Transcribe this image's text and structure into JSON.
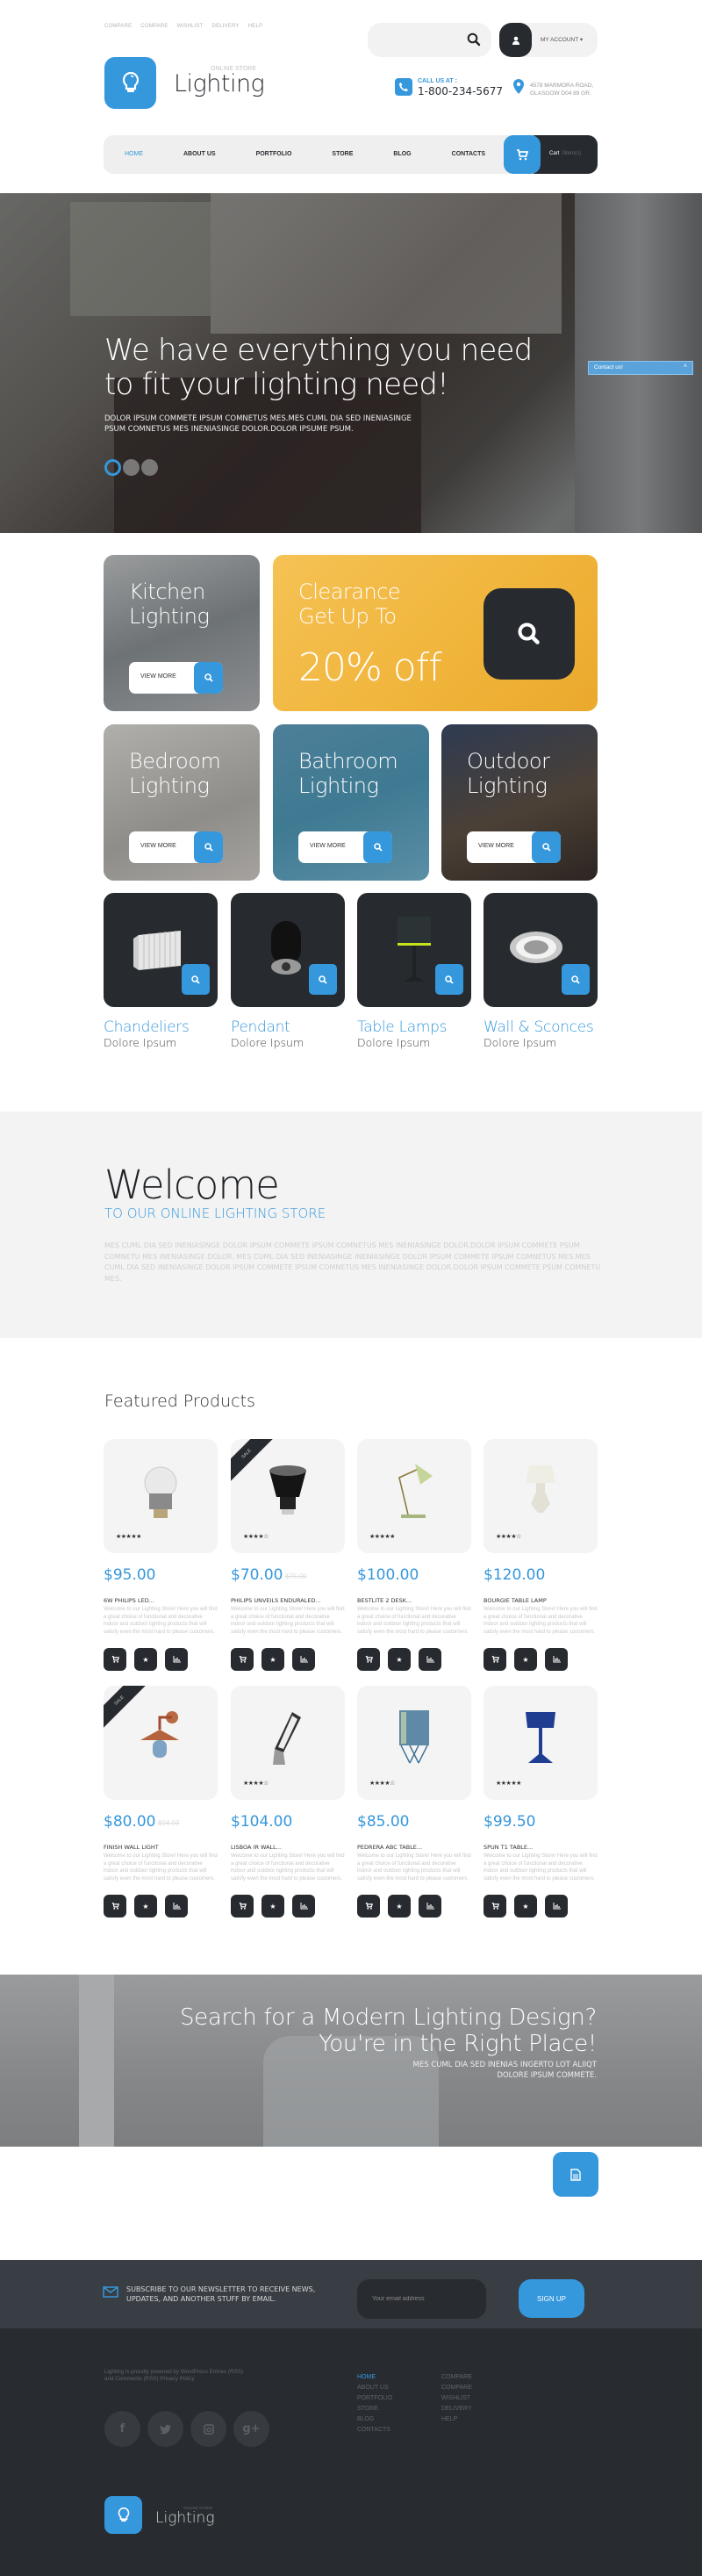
{
  "header": {
    "top_links": [
      "COMPARE",
      "COMPARE",
      "WISHLIST",
      "DELIVERY",
      "HELP"
    ],
    "logo": {
      "subtitle": "ONLINE STORE",
      "title": "Lighting",
      "icon": "lightbulb-icon"
    },
    "search": {
      "placeholder": "",
      "icon": "search-icon"
    },
    "account": {
      "label": "MY ACCOUNT",
      "icon": "user-icon"
    },
    "call": {
      "label": "CALL US AT :",
      "number": "1-800-234-5677",
      "icon": "phone-icon"
    },
    "address": {
      "line1": "4578 MARMORA ROAD,",
      "line2": "GLASGOW D04 89 GR.",
      "icon": "map-pin-icon"
    }
  },
  "nav": {
    "items": [
      {
        "label": "HOME",
        "active": true
      },
      {
        "label": "ABOUT US",
        "active": false
      },
      {
        "label": "PORTFOLIO",
        "active": false
      },
      {
        "label": "STORE",
        "active": false
      },
      {
        "label": "BLOG",
        "active": false
      },
      {
        "label": "CONTACTS",
        "active": false
      }
    ],
    "cart": {
      "label": "Cart",
      "count": "0item(s)",
      "icon": "cart-icon"
    }
  },
  "hero": {
    "title_line1": "We have everything you need",
    "title_line2": "to fit your lighting need!",
    "text_line1": "DOLOR IPSUM COMMETE IPSUM COMNETUS MES.MES CUML DIA SED INENIASINGE",
    "text_line2": "PSUM COMNETUS MES INENIASINGE DOLOR.DOLOR IPSUME PSUM.",
    "slides": 3,
    "active_slide": 1,
    "contact_tab": "Contact us!"
  },
  "categories": {
    "view_more": "VIEW MORE",
    "kitchen": {
      "line1": "Kitchen",
      "line2": "Lighting"
    },
    "clearance": {
      "line1": "Clearance",
      "line2": "Get Up To",
      "offer": "20% off"
    },
    "bedroom": {
      "line1": "Bedroom",
      "line2": "Lighting"
    },
    "bathroom": {
      "line1": "Bathroom",
      "line2": "Lighting"
    },
    "outdoor": {
      "line1": "Outdoor",
      "line2": "Lighting"
    }
  },
  "product_categories": [
    {
      "name": "Chandeliers",
      "sub": "Dolore Ipsum"
    },
    {
      "name": "Pendant",
      "sub": "Dolore Ipsum"
    },
    {
      "name": "Table Lamps",
      "sub": "Dolore Ipsum"
    },
    {
      "name": "Wall & Sconces",
      "sub": "Dolore Ipsum"
    }
  ],
  "welcome": {
    "title": "Welcome",
    "subtitle": "TO OUR ONLINE LIGHTING STORE",
    "text": "MES CUML DIA SED INENIASINGE DOLOR IPSUM COMMETE IPSUM COMNETUS MES INENIASINGE DOLOR.DOLOR IPSUM COMMETE PSUM COMNETU MES INENIASINGE DOLOR. MES CUML DIA SED INENIASINGE INENIASINGE DOLOR IPSUM COMMETE IPSUM COMNETUS MES.MES CUML DIA SED INENIASINGE DOLOR IPSUM COMMETE IPSUM COMNETUS MES INENIASINGE DOLOR.DOLOR IPSUM COMMETE PSUM COMNETU MES."
  },
  "featured": {
    "title": "Featured Products",
    "sale_label": "SALE",
    "description": "Welcome to our Lighting Store! Here you will find a great choice of functional and decorative indoor and outdoor lighting products that will satisfy even the most hard to please customers.",
    "products": [
      {
        "name": "6W PHILIPS LED...",
        "price": "$95.00",
        "old_price": "",
        "stars": "★★★★★",
        "sale": false
      },
      {
        "name": "PHILIPS UNVEILS ENDURALED...",
        "price": "$70.00",
        "old_price": "$75.00",
        "stars": "★★★★☆",
        "sale": true
      },
      {
        "name": "BESTLITE 2 DESK...",
        "price": "$100.00",
        "old_price": "",
        "stars": "★★★★★",
        "sale": false
      },
      {
        "name": "BOURGIE TABLE LAMP",
        "price": "$120.00",
        "old_price": "",
        "stars": "★★★★☆",
        "sale": false
      },
      {
        "name": "FINISH WALL LIGHT",
        "price": "$80.00",
        "old_price": "$94.50",
        "stars": "",
        "sale": true
      },
      {
        "name": "LISBOA IR WALL...",
        "price": "$104.00",
        "old_price": "",
        "stars": "★★★★☆",
        "sale": false
      },
      {
        "name": "PEDRERA ABC TABLE...",
        "price": "$85.00",
        "old_price": "",
        "stars": "★★★★☆",
        "sale": false
      },
      {
        "name": "SPUN T1 TABLE...",
        "price": "$99.50",
        "old_price": "",
        "stars": "★★★★★",
        "sale": false
      }
    ],
    "action_icons": [
      "cart-icon",
      "star-icon",
      "chart-icon"
    ]
  },
  "banner": {
    "title_line1": "Search for a Modern Lighting Design?",
    "title_line2": "You're in the Right Place!",
    "text_line1": "MES CUML DIA SED INENIAS INGERTO LOT ALIIQT",
    "text_line2": "DOLORE IPSUM COMMETE."
  },
  "newsletter": {
    "text_line1": "SUBSCRIBE TO OUR NEWSLETTER TO RECEIVE NEWS,",
    "text_line2": "UPDATES, AND ANOTHER STUFF BY EMAIL.",
    "placeholder": "Your email address",
    "button": "SIGN UP"
  },
  "footer": {
    "copyright": "Lighting is proudly powered by WordPress Entries (RSS) and Comments (RSS) Privacy Policy",
    "socials": [
      "facebook-icon",
      "twitter-icon",
      "instagram-icon",
      "google-plus-icon"
    ],
    "nav1": [
      "HOME",
      "ABOUT US",
      "PORTFOLIO",
      "STORE",
      "BLOG",
      "CONTACTS"
    ],
    "nav2": [
      "COMPARE",
      "COMPARE",
      "WISHLIST",
      "DELIVERY",
      "HELP"
    ],
    "logo": {
      "subtitle": "ONLINE STORE",
      "title": "Lighting"
    }
  },
  "colors": {
    "accent": "#3597dc",
    "dark": "#272b30",
    "clearance": "#f2b840"
  }
}
